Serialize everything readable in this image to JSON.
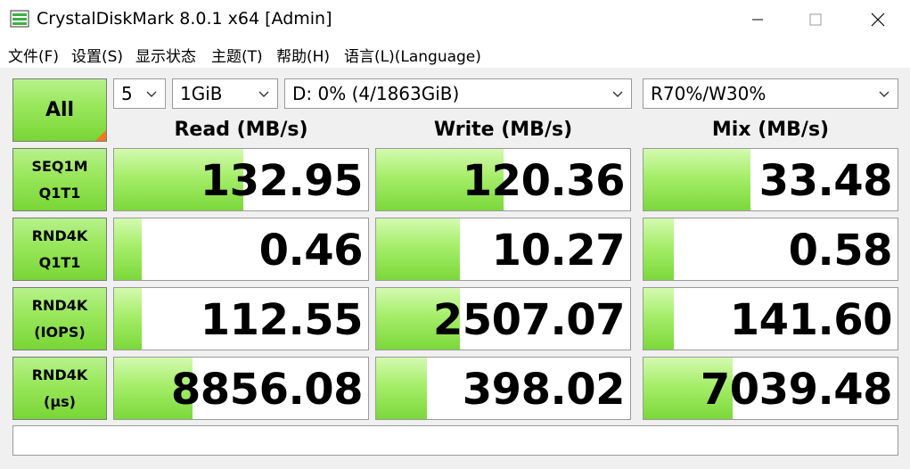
{
  "window": {
    "title": "CrystalDiskMark 8.0.1 x64 [Admin]",
    "icon": "crystaldiskmark-icon",
    "controls": [
      "minimize-icon",
      "maximize-icon",
      "close-icon"
    ]
  },
  "menu": [
    {
      "label": "文件(F)"
    },
    {
      "label": "设置(S)"
    },
    {
      "label": "显示状态"
    },
    {
      "label": "主题(T)"
    },
    {
      "label": "帮助(H)"
    },
    {
      "label": "语言(L)(Language)"
    }
  ],
  "toolbar": {
    "all_label": "All",
    "count": "5",
    "size": "1GiB",
    "drive": "D: 0% (4/1863GiB)",
    "mix_ratio": "R70%/W30%"
  },
  "columns": {
    "read": "Read (MB/s)",
    "write": "Write (MB/s)",
    "mix": "Mix (MB/s)"
  },
  "rows": [
    {
      "label1": "SEQ1M",
      "label2": "Q1T1",
      "read": "132.95",
      "write": "120.36",
      "mix": "33.48",
      "read_level": 0.51,
      "write_level": 0.5,
      "mix_level": 0.42
    },
    {
      "label1": "RND4K",
      "label2": "Q1T1",
      "read": "0.46",
      "write": "10.27",
      "mix": "0.58",
      "read_level": 0.11,
      "write_level": 0.33,
      "mix_level": 0.12
    },
    {
      "label1": "RND4K",
      "label2": "(IOPS)",
      "read": "112.55",
      "write": "2507.07",
      "mix": "141.60",
      "read_level": 0.11,
      "write_level": 0.33,
      "mix_level": 0.12
    },
    {
      "label1": "RND4K",
      "label2": "(μs)",
      "read": "8856.08",
      "write": "398.02",
      "mix": "7039.48",
      "read_level": 0.31,
      "write_level": 0.2,
      "mix_level": 0.35
    }
  ],
  "status": "",
  "colors": {
    "bar_green": "#7bd83a",
    "label_green": "#9be85e",
    "corner_orange": "#f07a1a",
    "close_x": "#000000"
  }
}
